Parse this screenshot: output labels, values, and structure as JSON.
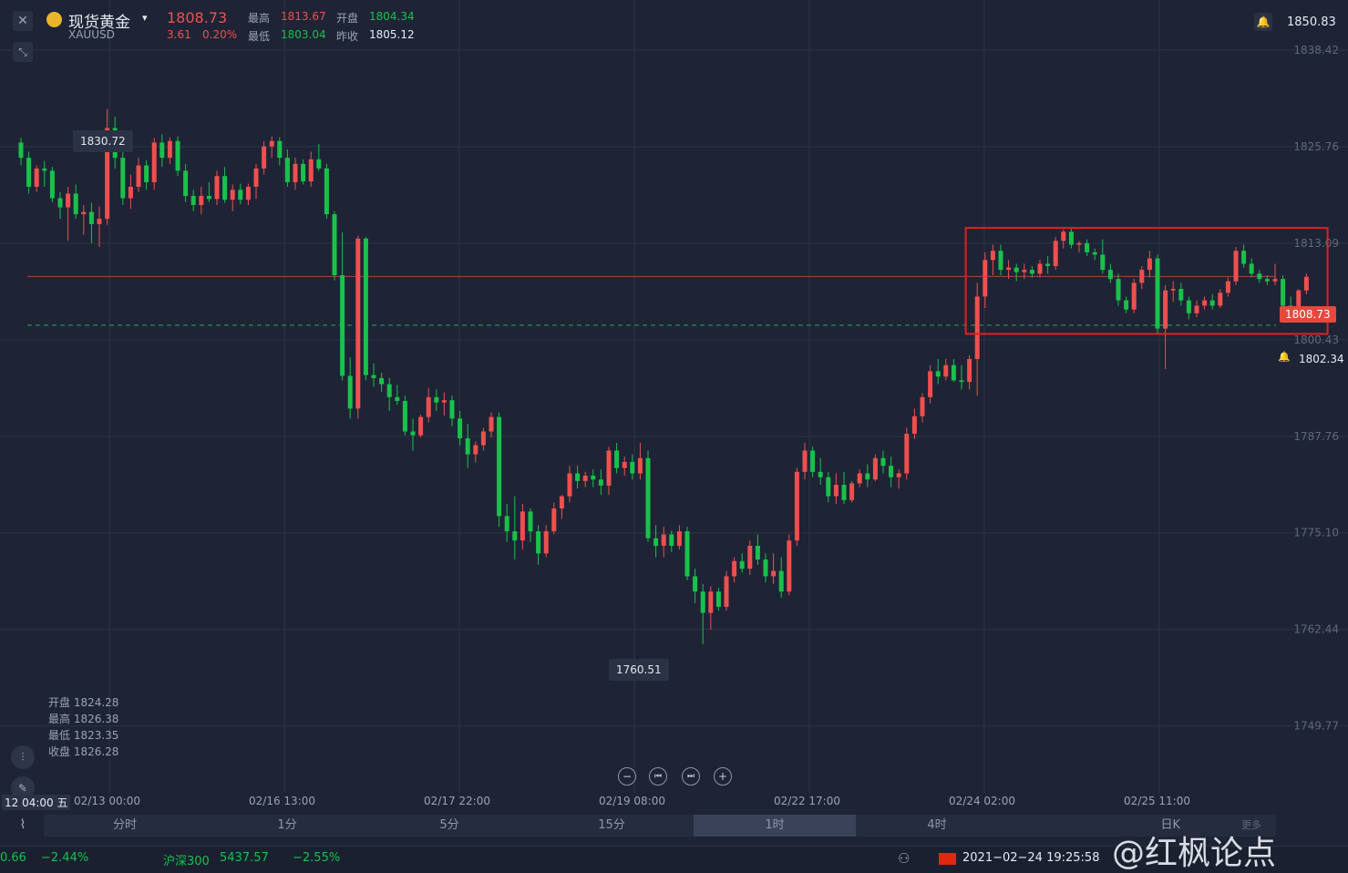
{
  "header": {
    "title": "现货黄金",
    "symbol": "XAUUSD",
    "price": "1808.73",
    "change": "3.61",
    "change_pct": "0.20%",
    "high_label": "最高",
    "high": "1813.67",
    "low_label": "最低",
    "low": "1803.04",
    "open_label": "开盘",
    "open": "1804.34",
    "prev_close_label": "昨收",
    "prev_close": "1805.12",
    "alert_price": "1850.83",
    "close_icon": "close-icon",
    "shrink_icon": "shrink-icon",
    "bell_icon": "bell-icon",
    "gold_icon": "gold-coin-icon"
  },
  "ohlc_panel": {
    "open": "开盘 1824.28",
    "high": "最高 1826.38",
    "low": "最低 1823.35",
    "close": "收盘 1826.28"
  },
  "markers": {
    "high_value": "1830.72",
    "low_value": "1760.51",
    "current_price": "1808.73",
    "alert_line_price": "1802.34"
  },
  "x_axis": {
    "cursor_label": "12 04:00 五",
    "labels": [
      "02/13 00:00",
      "02/16 13:00",
      "02/17 22:00",
      "02/19 08:00",
      "02/22 17:00",
      "02/24 02:00",
      "02/25 11:00"
    ]
  },
  "periods": {
    "items": [
      "分时",
      "1分",
      "5分",
      "15分",
      "1时",
      "4时",
      "日K"
    ],
    "active": "1时",
    "more": "更多"
  },
  "bottom_bar": {
    "left_value": "0.66",
    "left_pct": "−2.44%",
    "index_name": "沪深300",
    "index_value": "5437.57",
    "index_pct": "−2.55%",
    "datetime": "2021−02−24 19:25:58",
    "watermark": "@红枫论点"
  },
  "colors": {
    "up": "#ef4f4f",
    "down": "#19c14b",
    "background": "#1e2435",
    "highlight_box": "#e02020",
    "price_tag": "#e8483c"
  },
  "chart_data": {
    "type": "candlestick",
    "ylim": [
      1741,
      1845
    ],
    "y_ticks": [
      1838.42,
      1825.76,
      1813.09,
      1800.43,
      1787.76,
      1775.1,
      1762.44,
      1749.77
    ],
    "y_tick_labels": [
      "1838.42",
      "1825.76",
      "1813.09",
      "1800.43",
      "1787.76",
      "1775.10",
      "1762.44",
      "1749.77"
    ],
    "current_price": 1808.73,
    "alert_line": 1802.34,
    "highlight_range": {
      "x_from_index": 121,
      "x_to_index": 166,
      "y_from": 1801.2,
      "y_to": 1815.1
    },
    "marked_high": 1830.72,
    "marked_low": 1760.51,
    "candles": [
      [
        1826.3,
        1826.9,
        1823.3,
        1824.3
      ],
      [
        1824.3,
        1825.1,
        1819.6,
        1820.5
      ],
      [
        1820.5,
        1823.3,
        1819.8,
        1822.9
      ],
      [
        1822.9,
        1823.9,
        1820.5,
        1822.6
      ],
      [
        1822.6,
        1823.1,
        1818.5,
        1819.0
      ],
      [
        1819.0,
        1819.8,
        1816.3,
        1817.8
      ],
      [
        1817.8,
        1820.5,
        1813.4,
        1819.6
      ],
      [
        1819.6,
        1820.8,
        1816.3,
        1816.9
      ],
      [
        1816.9,
        1818.1,
        1814.2,
        1817.2
      ],
      [
        1817.2,
        1818.4,
        1813.1,
        1815.6
      ],
      [
        1815.6,
        1817.9,
        1812.6,
        1816.3
      ],
      [
        1816.3,
        1830.7,
        1815.5,
        1828.2
      ],
      [
        1828.2,
        1829.7,
        1822.9,
        1824.3
      ],
      [
        1824.3,
        1825.4,
        1818.1,
        1819.0
      ],
      [
        1819.0,
        1822.1,
        1817.6,
        1820.5
      ],
      [
        1820.5,
        1824.3,
        1819.8,
        1823.3
      ],
      [
        1823.3,
        1824.0,
        1820.1,
        1821.1
      ],
      [
        1821.1,
        1826.9,
        1820.1,
        1826.3
      ],
      [
        1826.3,
        1827.4,
        1823.1,
        1824.3
      ],
      [
        1824.3,
        1827.0,
        1823.5,
        1826.5
      ],
      [
        1826.5,
        1827.1,
        1821.9,
        1822.6
      ],
      [
        1822.6,
        1823.5,
        1818.5,
        1819.3
      ],
      [
        1819.3,
        1820.1,
        1817.3,
        1818.1
      ],
      [
        1818.1,
        1820.5,
        1816.9,
        1819.3
      ],
      [
        1819.3,
        1821.1,
        1818.5,
        1818.9
      ],
      [
        1818.9,
        1822.6,
        1818.1,
        1821.9
      ],
      [
        1821.9,
        1823.1,
        1818.4,
        1818.8
      ],
      [
        1818.8,
        1820.8,
        1817.3,
        1820.1
      ],
      [
        1820.1,
        1820.9,
        1818.2,
        1818.8
      ],
      [
        1818.8,
        1820.9,
        1818.1,
        1820.5
      ],
      [
        1820.5,
        1823.5,
        1818.9,
        1822.9
      ],
      [
        1822.9,
        1826.5,
        1822.1,
        1825.8
      ],
      [
        1825.8,
        1827.1,
        1824.3,
        1826.5
      ],
      [
        1826.5,
        1827.0,
        1823.3,
        1824.3
      ],
      [
        1824.3,
        1825.4,
        1820.5,
        1821.1
      ],
      [
        1821.1,
        1824.3,
        1820.1,
        1823.5
      ],
      [
        1823.5,
        1824.1,
        1820.8,
        1821.2
      ],
      [
        1821.2,
        1825.1,
        1820.5,
        1824.1
      ],
      [
        1824.1,
        1826.1,
        1822.6,
        1822.9
      ],
      [
        1822.9,
        1823.5,
        1816.3,
        1816.9
      ],
      [
        1816.9,
        1817.3,
        1808.2,
        1808.9
      ],
      [
        1808.9,
        1814.5,
        1795.1,
        1795.7
      ],
      [
        1795.7,
        1798.1,
        1790.1,
        1791.4
      ],
      [
        1791.4,
        1814.1,
        1790.1,
        1813.7
      ],
      [
        1813.7,
        1813.9,
        1795.1,
        1795.8
      ],
      [
        1795.8,
        1797.3,
        1794.3,
        1795.4
      ],
      [
        1795.4,
        1796.1,
        1793.6,
        1794.6
      ],
      [
        1794.6,
        1795.4,
        1791.1,
        1792.9
      ],
      [
        1792.9,
        1794.5,
        1791.9,
        1792.4
      ],
      [
        1792.4,
        1793.1,
        1787.9,
        1788.4
      ],
      [
        1788.4,
        1790.1,
        1785.9,
        1787.9
      ],
      [
        1787.9,
        1790.6,
        1787.6,
        1790.3
      ],
      [
        1790.3,
        1794.1,
        1789.6,
        1792.9
      ],
      [
        1792.9,
        1793.9,
        1791.1,
        1792.2
      ],
      [
        1792.2,
        1793.5,
        1790.5,
        1792.5
      ],
      [
        1792.5,
        1793.1,
        1789.1,
        1790.1
      ],
      [
        1790.1,
        1791.1,
        1786.6,
        1787.5
      ],
      [
        1787.5,
        1789.4,
        1783.6,
        1785.4
      ],
      [
        1785.4,
        1787.1,
        1784.3,
        1786.6
      ],
      [
        1786.6,
        1788.9,
        1785.9,
        1788.4
      ],
      [
        1788.4,
        1790.9,
        1787.6,
        1790.3
      ],
      [
        1790.3,
        1790.9,
        1775.9,
        1777.3
      ],
      [
        1777.3,
        1778.9,
        1773.9,
        1775.3
      ],
      [
        1775.3,
        1779.9,
        1771.6,
        1774.1
      ],
      [
        1774.1,
        1778.9,
        1772.9,
        1777.9
      ],
      [
        1777.9,
        1778.3,
        1773.9,
        1775.3
      ],
      [
        1775.3,
        1776.1,
        1770.9,
        1772.4
      ],
      [
        1772.4,
        1776.1,
        1771.9,
        1775.3
      ],
      [
        1775.3,
        1779.1,
        1774.9,
        1778.3
      ],
      [
        1778.3,
        1780.1,
        1776.9,
        1779.9
      ],
      [
        1779.9,
        1783.9,
        1779.1,
        1782.9
      ],
      [
        1782.9,
        1783.9,
        1780.9,
        1781.9
      ],
      [
        1781.9,
        1783.1,
        1781.1,
        1782.6
      ],
      [
        1782.6,
        1783.4,
        1781.1,
        1782.1
      ],
      [
        1782.1,
        1783.4,
        1780.1,
        1781.3
      ],
      [
        1781.3,
        1786.4,
        1780.1,
        1785.9
      ],
      [
        1785.9,
        1786.9,
        1782.9,
        1783.6
      ],
      [
        1783.6,
        1785.1,
        1782.6,
        1784.4
      ],
      [
        1784.4,
        1785.4,
        1782.1,
        1782.9
      ],
      [
        1782.9,
        1786.9,
        1782.1,
        1784.9
      ],
      [
        1784.9,
        1785.9,
        1773.9,
        1774.4
      ],
      [
        1774.4,
        1776.1,
        1771.9,
        1773.4
      ],
      [
        1773.4,
        1775.9,
        1771.9,
        1774.9
      ],
      [
        1774.9,
        1775.4,
        1772.6,
        1773.4
      ],
      [
        1773.4,
        1776.1,
        1772.9,
        1775.3
      ],
      [
        1775.3,
        1775.9,
        1768.9,
        1769.4
      ],
      [
        1769.4,
        1770.4,
        1765.9,
        1767.4
      ],
      [
        1767.4,
        1768.4,
        1760.5,
        1764.6
      ],
      [
        1764.6,
        1768.1,
        1762.4,
        1767.4
      ],
      [
        1767.4,
        1767.9,
        1764.9,
        1765.4
      ],
      [
        1765.4,
        1770.1,
        1764.9,
        1769.4
      ],
      [
        1769.4,
        1771.9,
        1768.6,
        1771.4
      ],
      [
        1771.4,
        1772.4,
        1769.9,
        1770.4
      ],
      [
        1770.4,
        1774.1,
        1769.6,
        1773.4
      ],
      [
        1773.4,
        1774.9,
        1770.9,
        1771.6
      ],
      [
        1771.6,
        1772.4,
        1768.6,
        1769.4
      ],
      [
        1769.4,
        1772.4,
        1768.4,
        1770.1
      ],
      [
        1770.1,
        1771.9,
        1766.6,
        1767.4
      ],
      [
        1767.4,
        1774.9,
        1766.9,
        1774.1
      ],
      [
        1774.1,
        1783.6,
        1773.4,
        1783.1
      ],
      [
        1783.1,
        1786.9,
        1782.1,
        1785.9
      ],
      [
        1785.9,
        1786.4,
        1782.4,
        1783.1
      ],
      [
        1783.1,
        1784.9,
        1781.4,
        1782.4
      ],
      [
        1782.4,
        1783.1,
        1779.1,
        1779.9
      ],
      [
        1779.9,
        1782.9,
        1778.9,
        1781.4
      ],
      [
        1781.4,
        1783.1,
        1778.9,
        1779.4
      ],
      [
        1779.4,
        1781.9,
        1779.1,
        1781.6
      ],
      [
        1781.6,
        1783.4,
        1781.1,
        1782.9
      ],
      [
        1782.9,
        1784.1,
        1781.1,
        1782.1
      ],
      [
        1782.1,
        1785.4,
        1781.9,
        1784.9
      ],
      [
        1784.9,
        1785.9,
        1782.9,
        1783.9
      ],
      [
        1783.9,
        1785.1,
        1781.1,
        1782.4
      ],
      [
        1782.4,
        1783.4,
        1780.9,
        1782.9
      ],
      [
        1782.9,
        1788.9,
        1782.1,
        1788.1
      ],
      [
        1788.1,
        1791.4,
        1787.4,
        1790.4
      ],
      [
        1790.4,
        1793.4,
        1789.6,
        1792.9
      ],
      [
        1792.9,
        1797.1,
        1792.1,
        1796.3
      ],
      [
        1796.3,
        1797.9,
        1794.6,
        1795.6
      ],
      [
        1795.6,
        1797.9,
        1795.1,
        1797.1
      ],
      [
        1797.1,
        1797.9,
        1794.9,
        1795.1
      ],
      [
        1795.1,
        1797.1,
        1793.9,
        1794.9
      ],
      [
        1794.9,
        1798.4,
        1793.9,
        1797.9
      ],
      [
        1797.9,
        1807.9,
        1793.1,
        1806.1
      ],
      [
        1806.1,
        1811.9,
        1804.6,
        1810.9
      ],
      [
        1810.9,
        1812.9,
        1808.9,
        1812.1
      ],
      [
        1812.1,
        1812.9,
        1808.9,
        1809.6
      ],
      [
        1809.6,
        1810.9,
        1808.4,
        1809.9
      ],
      [
        1809.9,
        1810.4,
        1808.1,
        1809.3
      ],
      [
        1809.3,
        1810.4,
        1808.4,
        1809.6
      ],
      [
        1809.6,
        1810.1,
        1808.6,
        1809.1
      ],
      [
        1809.1,
        1810.9,
        1808.6,
        1810.4
      ],
      [
        1810.4,
        1811.4,
        1809.1,
        1810.1
      ],
      [
        1810.1,
        1813.9,
        1809.6,
        1813.4
      ],
      [
        1813.4,
        1814.9,
        1812.4,
        1814.6
      ],
      [
        1814.6,
        1815.1,
        1812.4,
        1812.9
      ],
      [
        1812.9,
        1813.4,
        1811.9,
        1813.1
      ],
      [
        1813.1,
        1813.6,
        1811.4,
        1811.9
      ],
      [
        1811.9,
        1812.4,
        1810.9,
        1811.6
      ],
      [
        1811.6,
        1813.6,
        1809.1,
        1809.6
      ],
      [
        1809.6,
        1810.4,
        1807.9,
        1808.4
      ],
      [
        1808.4,
        1809.1,
        1804.9,
        1805.6
      ],
      [
        1805.6,
        1806.1,
        1803.9,
        1804.4
      ],
      [
        1804.4,
        1808.4,
        1803.9,
        1807.9
      ],
      [
        1807.9,
        1810.1,
        1807.1,
        1809.6
      ],
      [
        1809.6,
        1812.1,
        1808.6,
        1811.1
      ],
      [
        1811.1,
        1811.6,
        1801.1,
        1801.9
      ],
      [
        1801.9,
        1807.6,
        1796.6,
        1806.9
      ],
      [
        1806.9,
        1808.1,
        1805.4,
        1807.1
      ],
      [
        1807.1,
        1807.9,
        1804.9,
        1805.6
      ],
      [
        1805.6,
        1806.1,
        1803.1,
        1803.9
      ],
      [
        1803.9,
        1805.6,
        1803.4,
        1804.9
      ],
      [
        1804.9,
        1806.1,
        1804.4,
        1805.6
      ],
      [
        1805.6,
        1806.4,
        1804.4,
        1804.9
      ],
      [
        1804.9,
        1807.1,
        1804.6,
        1806.6
      ],
      [
        1806.6,
        1808.6,
        1806.1,
        1808.1
      ],
      [
        1808.1,
        1812.6,
        1807.6,
        1812.1
      ],
      [
        1812.1,
        1812.9,
        1809.9,
        1810.4
      ],
      [
        1810.4,
        1811.1,
        1808.6,
        1809.1
      ],
      [
        1809.1,
        1809.6,
        1807.9,
        1808.4
      ],
      [
        1808.4,
        1808.9,
        1807.6,
        1808.1
      ],
      [
        1808.1,
        1810.4,
        1807.6,
        1808.4
      ],
      [
        1808.4,
        1808.9,
        1804.4,
        1804.9
      ],
      [
        1804.9,
        1806.1,
        1803.4,
        1804.4
      ],
      [
        1804.4,
        1807.1,
        1803.9,
        1806.9
      ],
      [
        1806.9,
        1809.1,
        1806.4,
        1808.7
      ]
    ]
  }
}
